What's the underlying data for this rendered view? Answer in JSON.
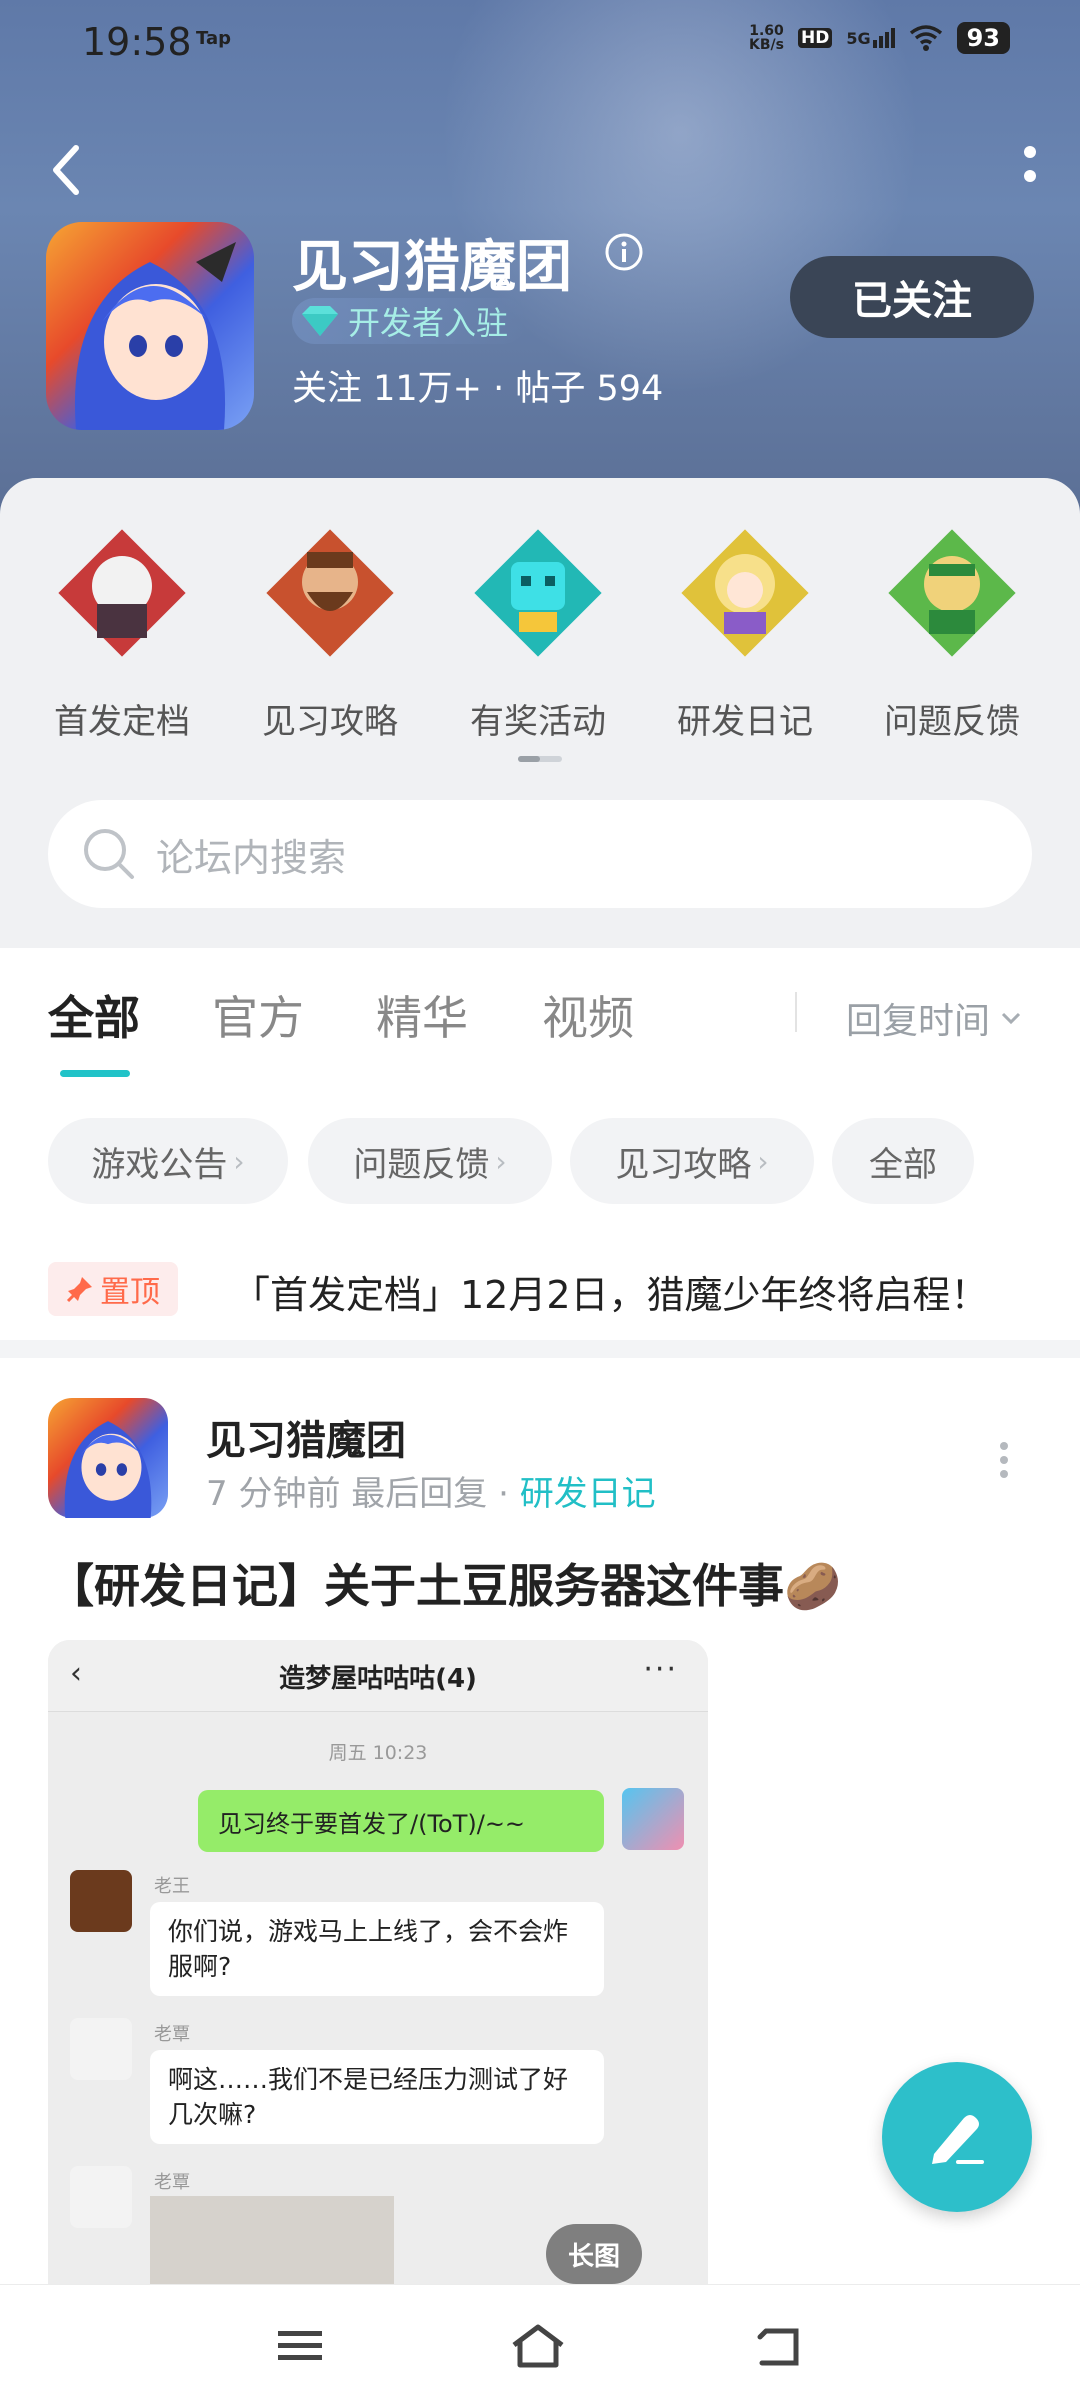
{
  "status_bar": {
    "time": "19:58",
    "tap": "Tap",
    "net_speed": "1.60\nKB/s",
    "hd": "HD",
    "net": "5G",
    "battery": "93"
  },
  "header": {
    "title": "见习猎魔团",
    "dev_badge": "开发者入驻",
    "stats": "关注 11万+  ·  帖子 594",
    "follow_label": "已关注"
  },
  "shortcuts": [
    {
      "label": "首发定档",
      "color": "#c73a3a",
      "icon": "white-haired-girl-icon"
    },
    {
      "label": "见习攻略",
      "color": "#c8512e",
      "icon": "bearded-man-icon"
    },
    {
      "label": "有奖活动",
      "color": "#22b8b5",
      "icon": "cyan-creature-icon"
    },
    {
      "label": "研发日记",
      "color": "#e0c23a",
      "icon": "blonde-girl-icon"
    },
    {
      "label": "问题反馈",
      "color": "#5cb84a",
      "icon": "green-elf-icon"
    }
  ],
  "search": {
    "placeholder": "论坛内搜索"
  },
  "tabs": {
    "items": [
      "全部",
      "官方",
      "精华",
      "视频"
    ],
    "active": 0,
    "sort_label": "回复时间"
  },
  "chips": [
    "游戏公告",
    "问题反馈",
    "见习攻略",
    "全部"
  ],
  "pinned": {
    "badge": "置顶",
    "text": "「首发定档」12月2日，猎魔少年终将启程！"
  },
  "post": {
    "author": "见习猎魔团",
    "time": "7 分钟前 最后回复",
    "tag": "研发日记",
    "title": "【研发日记】关于土豆服务器这件事🥔",
    "long_image_tag": "长图",
    "chat": {
      "title": "造梦屋咕咕咕(4)",
      "time": "周五 10:23",
      "msg1": "见习终于要首发了/(ToT)/~~",
      "name2": "老王",
      "msg2": "你们说，游戏马上上线了，会不会炸服啊?",
      "name3": "老覃",
      "msg3": "啊这……我们不是已经压力测试了好几次嘛?",
      "name4": "老覃"
    }
  }
}
